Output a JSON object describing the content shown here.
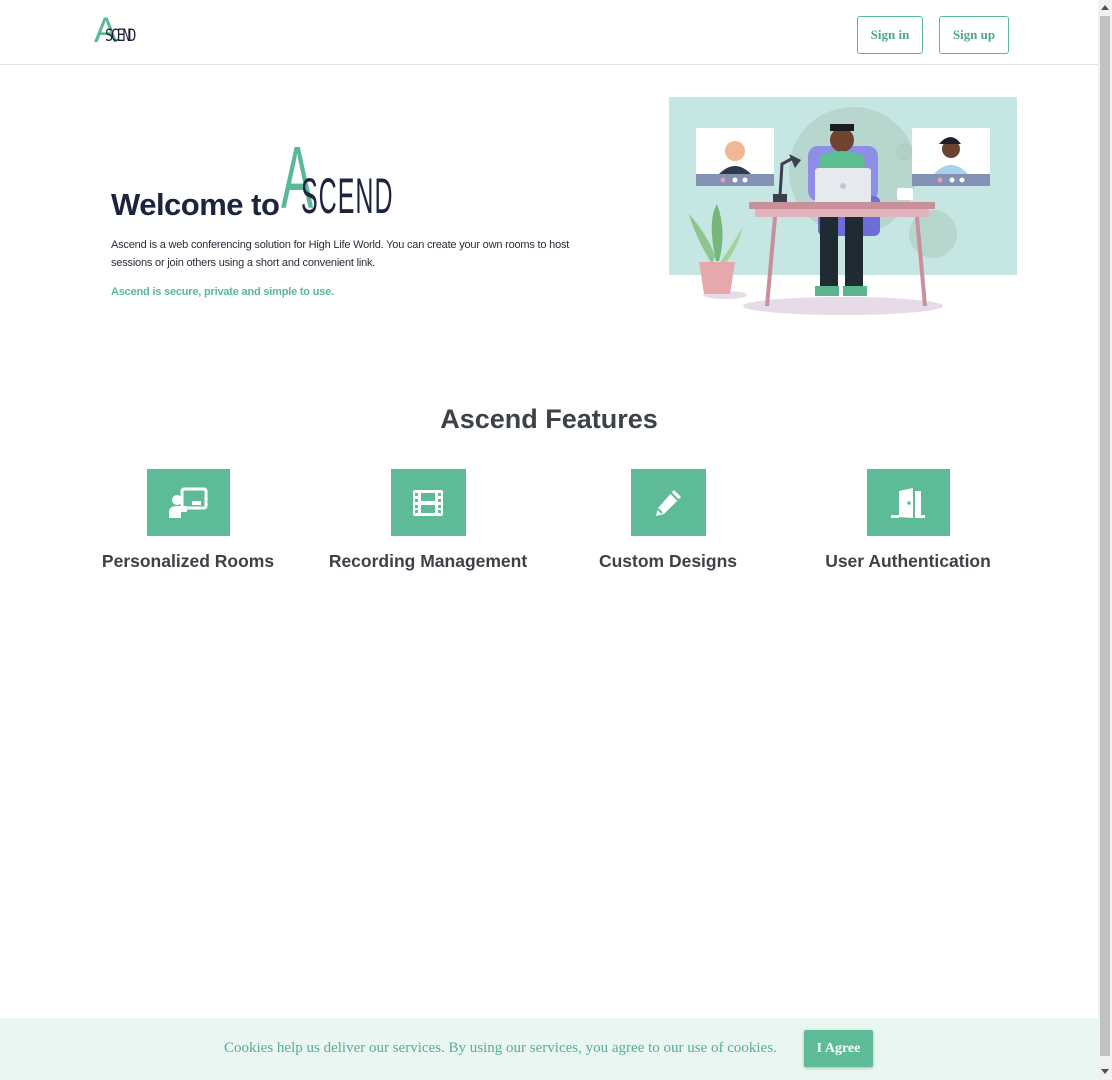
{
  "brand": {
    "logo_first": "A",
    "logo_rest": "SCEND"
  },
  "nav": {
    "sign_in": "Sign in",
    "sign_up": "Sign up"
  },
  "hero": {
    "welcome": "Welcome to",
    "logo_first": "A",
    "logo_rest": "SCEND",
    "description": "Ascend is a web conferencing solution for High Life World. You can create your own rooms to host sessions or join others using a short and convenient link.",
    "tagline": "Ascend is secure, private and simple to use."
  },
  "features": {
    "title": "Ascend Features",
    "items": [
      {
        "label": "Personalized Rooms",
        "icon": "chalkboard-teacher-icon"
      },
      {
        "label": "Recording Management",
        "icon": "film-icon"
      },
      {
        "label": "Custom Designs",
        "icon": "pencil-icon"
      },
      {
        "label": "User Authentication",
        "icon": "door-open-icon"
      }
    ]
  },
  "cookie": {
    "text": "Cookies help us deliver our services. By using our services, you agree to our use of cookies.",
    "agree": "I Agree"
  },
  "colors": {
    "accent": "#5dbb98",
    "navy": "#1e2340",
    "cookie_bg": "#eaf6f2"
  }
}
